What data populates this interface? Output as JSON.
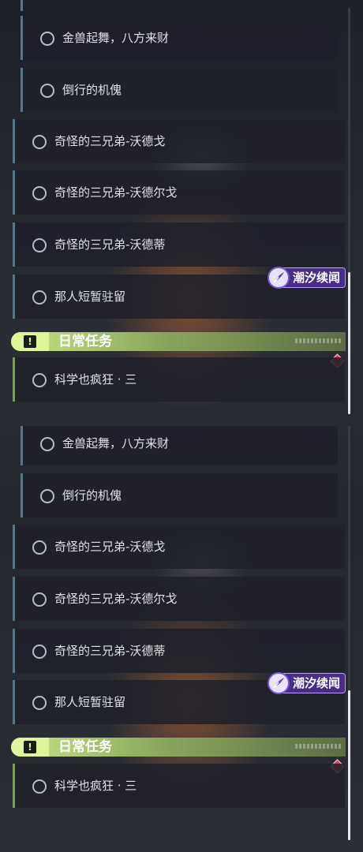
{
  "quests": {
    "sub_items": [
      {
        "label": "金兽起舞，八方来财"
      },
      {
        "label": "倒行的机傀"
      }
    ],
    "main_items": [
      {
        "label": "奇怪的三兄弟-沃德戈"
      },
      {
        "label": "奇怪的三兄弟-沃德尔戈"
      },
      {
        "label": "奇怪的三兄弟-沃德蒂"
      },
      {
        "label": "那人短暂驻留"
      }
    ]
  },
  "badge": {
    "label": "潮汐续闻",
    "icon": "tide-feather-icon",
    "color": "#4b2d8c"
  },
  "daily": {
    "title": "日常任务",
    "icon": "alert-box-icon",
    "accent": "#d5f18a",
    "items": [
      {
        "label": "科学也疯狂 · 三"
      }
    ]
  },
  "marker": {
    "icon": "red-diamond-icon",
    "color": "#d94358"
  }
}
